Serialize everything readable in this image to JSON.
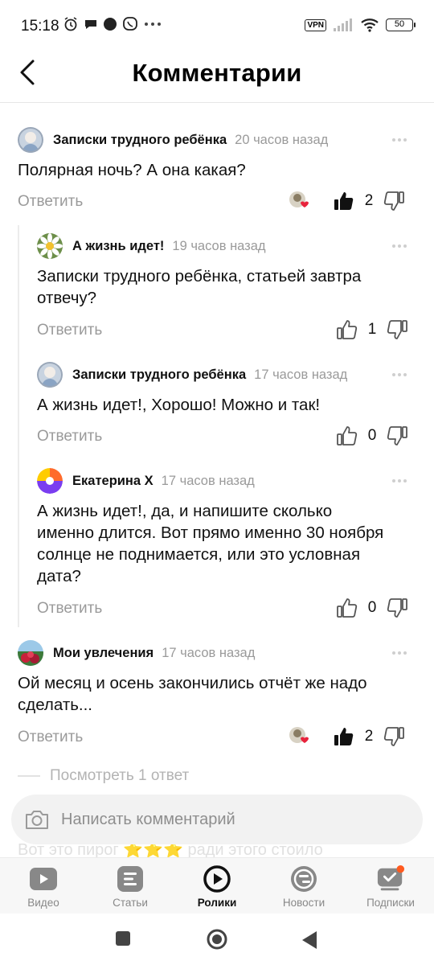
{
  "status_bar": {
    "time": "15:18",
    "vpn": "VPN",
    "battery": "50"
  },
  "header": {
    "title": "Комментарии"
  },
  "comments": [
    {
      "author": "Записки трудного ребёнка",
      "time": "20 часов назад",
      "text": "Полярная ночь? А она какая?",
      "reply": "Ответить",
      "likes": "2",
      "liked": true
    },
    {
      "author": "А жизнь идет!",
      "time": "19 часов назад",
      "text_lines": [
        "Записки трудного ребёнка, статьей завтра",
        "отвечу?"
      ],
      "reply": "Ответить",
      "likes": "1"
    },
    {
      "author": "Записки трудного ребёнка",
      "time": "17 часов назад",
      "text": "А жизнь идет!, Хорошо! Можно и так!",
      "reply": "Ответить",
      "likes": "0"
    },
    {
      "author": "Екатерина Х",
      "time": "17 часов назад",
      "text_lines": [
        "А жизнь идет!, да, и напишите сколько",
        "именно длится. Вот прямо именно 30 ноября",
        "солнце не поднимается, или это условная",
        "дата?"
      ],
      "reply": "Ответить",
      "likes": "0"
    },
    {
      "author": "Мои увлечения",
      "time": "17 часов назад",
      "text_lines": [
        "Ой месяц и осень закончились отчёт же надо",
        "сделать..."
      ],
      "reply": "Ответить",
      "likes": "2",
      "liked": true
    }
  ],
  "more_replies": "Посмотреть 1 ответ",
  "comment_input": {
    "placeholder": "Написать комментарий"
  },
  "faded_text": "Вот это пирог ⭐⭐⭐ ради этого стоило",
  "bottom_nav": [
    {
      "label": "Видео",
      "icon": "video-icon"
    },
    {
      "label": "Статьи",
      "icon": "articles-icon"
    },
    {
      "label": "Ролики",
      "icon": "shorts-icon",
      "active": true
    },
    {
      "label": "Новости",
      "icon": "news-icon"
    },
    {
      "label": "Подписки",
      "icon": "subscriptions-icon",
      "badge": true
    }
  ],
  "colors": {
    "accent": "#111111",
    "muted": "#9a9a9a",
    "badge": "#ff5a1f"
  }
}
